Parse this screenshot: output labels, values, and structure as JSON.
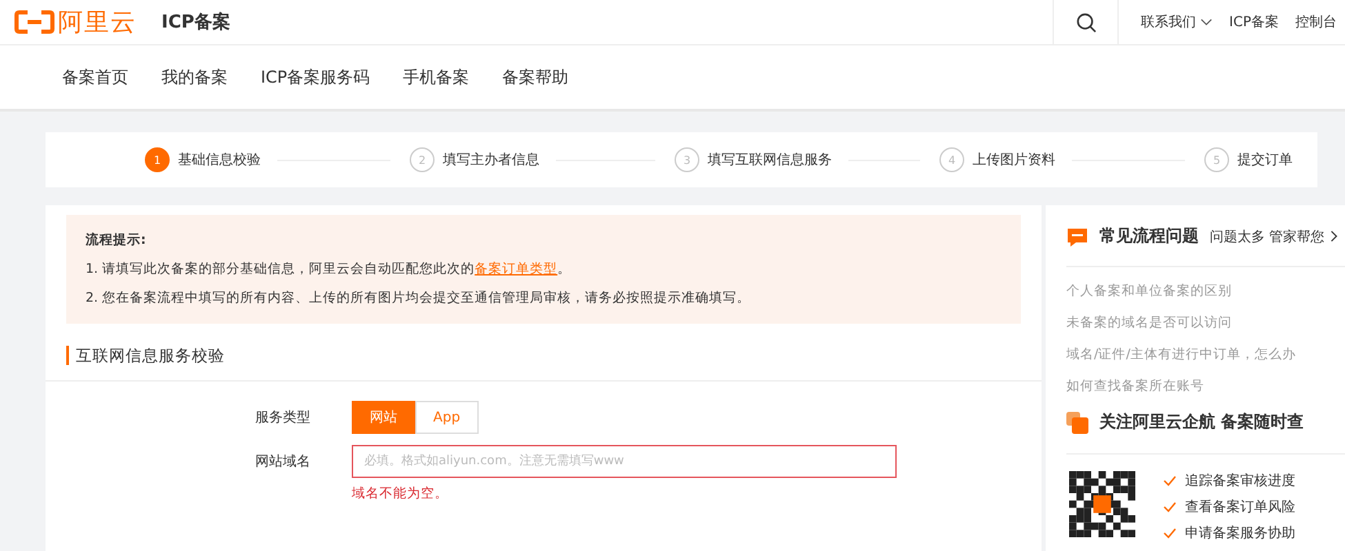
{
  "header": {
    "logo_text": "阿里云",
    "title": "ICP备案",
    "links": [
      {
        "label": "联系我们",
        "dropdown": true
      },
      {
        "label": "ICP备案",
        "dropdown": false
      },
      {
        "label": "控制台",
        "dropdown": false
      }
    ]
  },
  "nav": [
    {
      "label": "备案首页"
    },
    {
      "label": "我的备案"
    },
    {
      "label": "ICP备案服务码"
    },
    {
      "label": "手机备案"
    },
    {
      "label": "备案帮助"
    }
  ],
  "steps": [
    {
      "number": "1",
      "label": "基础信息校验",
      "selected": true
    },
    {
      "number": "2",
      "label": "填写主办者信息",
      "selected": false
    },
    {
      "number": "3",
      "label": "填写互联网信息服务",
      "selected": false
    },
    {
      "number": "4",
      "label": "上传图片资料",
      "selected": false
    },
    {
      "number": "5",
      "label": "提交订单",
      "selected": false
    }
  ],
  "notice": {
    "title": "流程提示:",
    "items": [
      {
        "text": "1. 请填写此次备案的部分基础信息，阿里云会自动匹配您此次的",
        "link": "备案订单类型",
        "suffix": "。"
      },
      {
        "text": "2. 您在备案流程中填写的所有内容、上传的所有图片均会提交至通信管理局审核，请务必按照提示准确填写。"
      }
    ]
  },
  "section": {
    "title": "互联网信息服务校验",
    "service_type": {
      "label": "服务类型",
      "options": [
        {
          "label": "网站",
          "selected": true
        },
        {
          "label": "App",
          "selected": false
        }
      ]
    },
    "domain": {
      "label": "网站域名",
      "placeholder": "必填。格式如aliyun.com。注意无需填写www",
      "error": "域名不能为空。"
    }
  },
  "sidebar": {
    "faq_title": "常见流程问题",
    "faq_link": "问题太多 管家帮您",
    "faq_items": [
      "个人备案和单位备案的区别",
      "未备案的域名是否可以访问",
      "域名/证件/主体有进行中订单，怎么办",
      "如何查找备案所在账号"
    ],
    "follow_title": "关注阿里云企航 备案随时查",
    "features": [
      "追踪备案审核进度",
      "查看备案订单风险",
      "申请备案服务协助"
    ]
  }
}
